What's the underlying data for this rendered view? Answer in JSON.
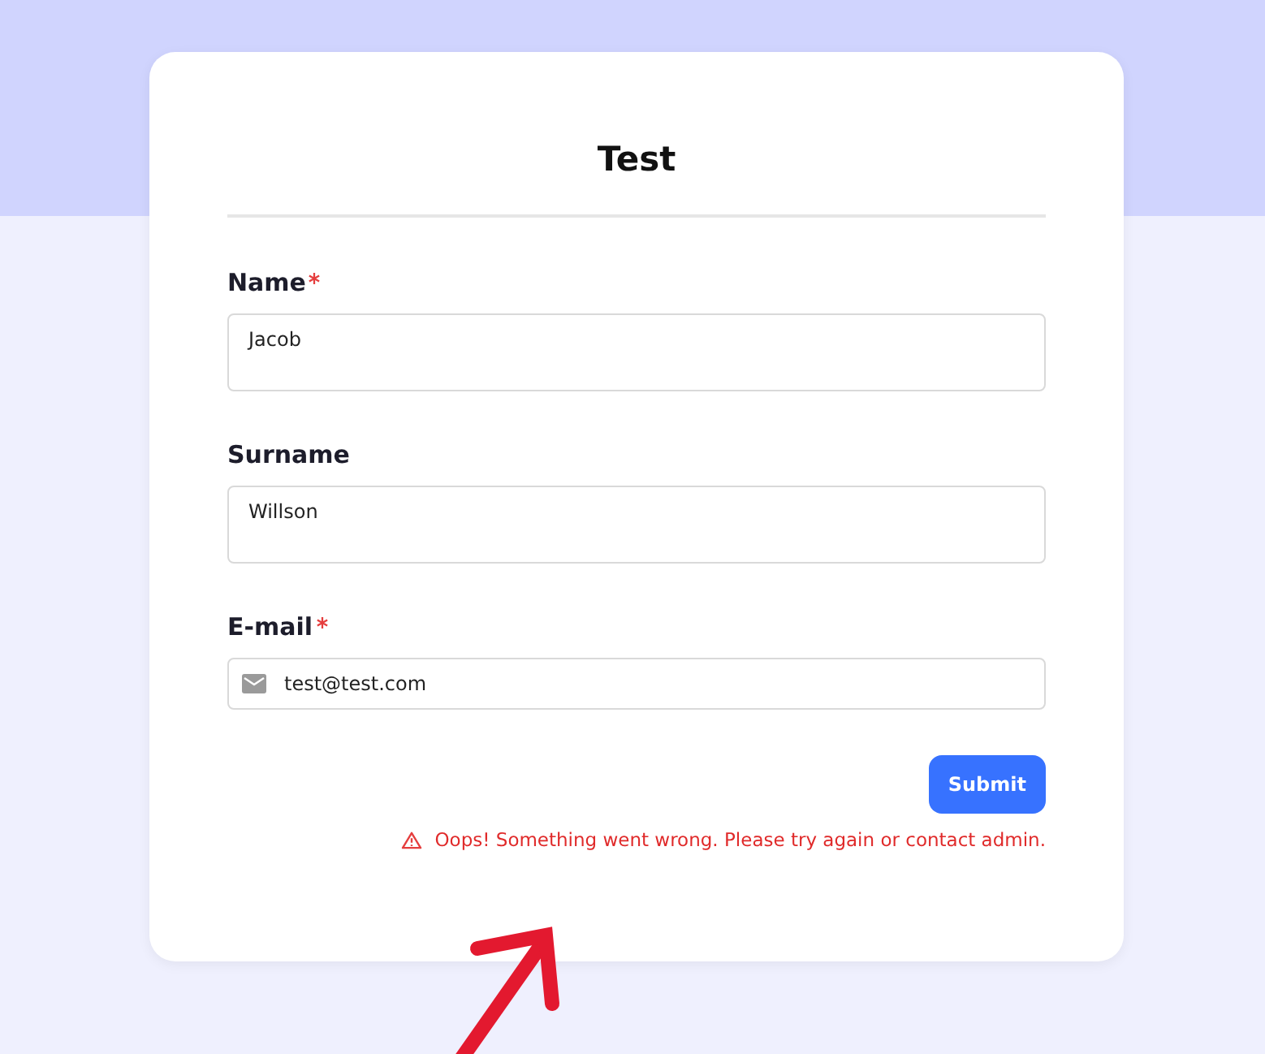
{
  "form": {
    "title": "Test",
    "fields": [
      {
        "kind": "multiline",
        "label": "Name",
        "required": true,
        "value": "Jacob"
      },
      {
        "kind": "multiline",
        "label": "Surname",
        "required": false,
        "value": "Willson"
      },
      {
        "kind": "email",
        "label": "E-mail",
        "required": true,
        "value": "test@test.com"
      }
    ],
    "submit": "Submit",
    "error": "Oops! Something went wrong. Please try again or contact admin."
  },
  "annotation": {
    "kind": "arrow"
  }
}
